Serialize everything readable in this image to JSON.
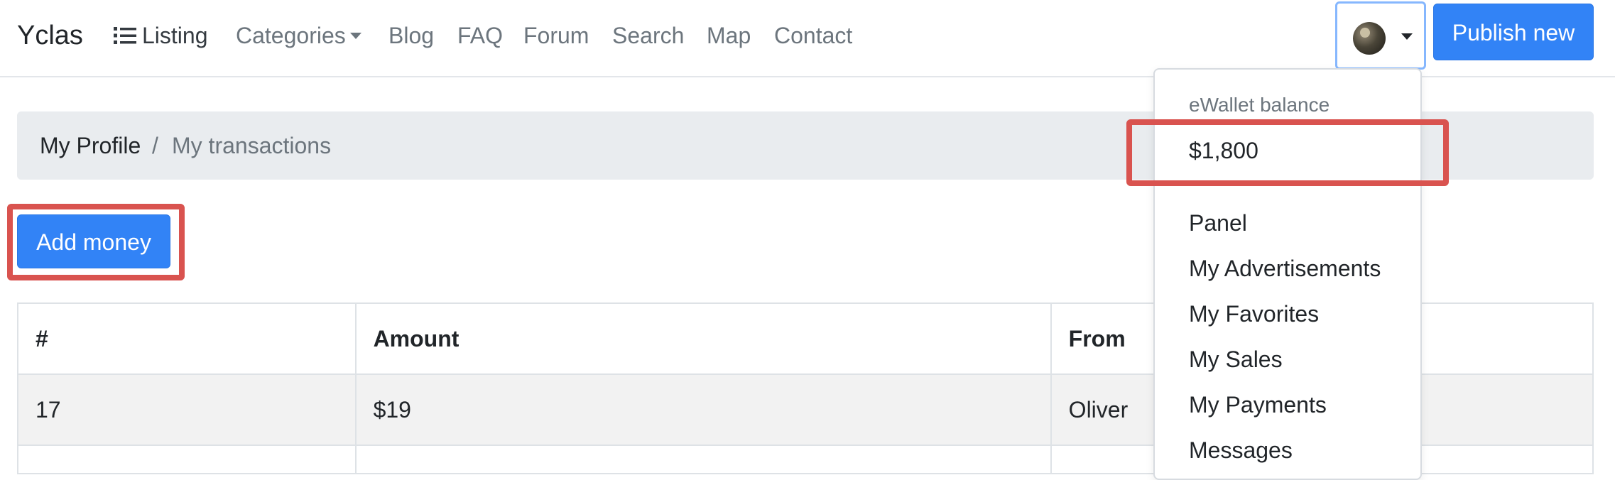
{
  "navbar": {
    "brand": "Yclas",
    "links": {
      "listing": "Listing",
      "categories": "Categories",
      "blog": "Blog",
      "faq": "FAQ",
      "forum": "Forum",
      "search": "Search",
      "map": "Map",
      "contact": "Contact"
    },
    "publish_label": "Publish new"
  },
  "breadcrumb": {
    "profile": "My Profile",
    "separator": "/",
    "current": "My transactions"
  },
  "actions": {
    "add_money_label": "Add money"
  },
  "table": {
    "headers": {
      "id": "#",
      "amount": "Amount",
      "from": "From"
    },
    "rows": [
      {
        "id": "17",
        "amount": "$19",
        "from": "Oliver"
      }
    ]
  },
  "user_menu": {
    "wallet_header": "eWallet balance",
    "wallet_balance": "$1,800",
    "items": {
      "panel": "Panel",
      "advertisements": "My Advertisements",
      "favorites": "My Favorites",
      "sales": "My Sales",
      "payments": "My Payments",
      "messages": "Messages"
    }
  },
  "colors": {
    "primary": "#3283f6",
    "highlight": "#d9534f",
    "breadcrumb_bg": "#e9ecef",
    "focus_ring": "#86b7fe"
  },
  "icons": {
    "listing": "list-icon",
    "categories": "caret-down-icon",
    "user_toggle": "caret-down-icon"
  }
}
